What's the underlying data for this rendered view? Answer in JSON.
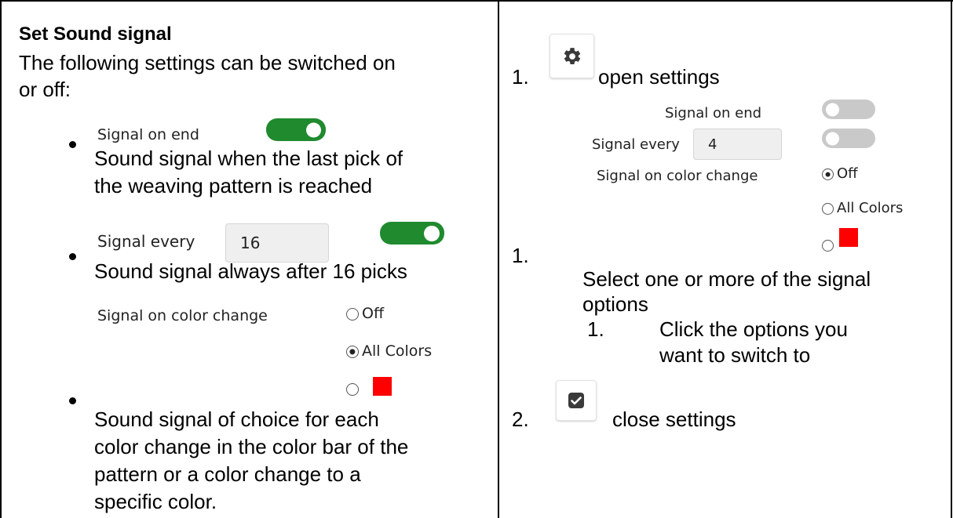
{
  "left": {
    "heading": "Set Sound signal",
    "intro_line1": "The following settings can be switched on",
    "intro_line2": "or off:",
    "item1": {
      "label": "Signal on end",
      "toggle_on": true,
      "desc_line1": "Sound signal when the last pick of",
      "desc_line2": "the weaving pattern is reached"
    },
    "item2": {
      "label": "Signal every",
      "value": "16",
      "toggle_on": true,
      "desc": "Sound signal always after 16 picks"
    },
    "item3": {
      "label": "Signal on color change",
      "option_off": "Off",
      "option_all": "All Colors",
      "selected": "All Colors",
      "swatch_color": "#ff0000",
      "desc_line1": "Sound signal of choice for each",
      "desc_line2": "color change in the color bar of the",
      "desc_line3": "pattern or a color change to a",
      "desc_line4": "specific color."
    }
  },
  "right": {
    "step1_number": "1.",
    "step1_text": "open settings",
    "settings_icon": "gear-icon",
    "panel": {
      "signal_on_end_label": "Signal on end",
      "signal_every_label": "Signal every",
      "signal_every_value": "4",
      "color_change_label": "Signal on color change",
      "option_off": "Off",
      "option_all": "All Colors",
      "selected": "Off",
      "swatch_color": "#ff0000"
    },
    "step_b_number": "1.",
    "step_b_line1": "Select one or more of the signal",
    "step_b_line2": "options",
    "sub_number": "1.",
    "sub_line1": "Click the options you",
    "sub_line2": "want to switch to",
    "step2_number": "2.",
    "step2_text": "close settings",
    "close_icon": "checkbox-check-icon"
  },
  "colors": {
    "toggle_on": "#1f8a2e",
    "toggle_off": "#c9c9c9",
    "swatch": "#ff0000"
  }
}
